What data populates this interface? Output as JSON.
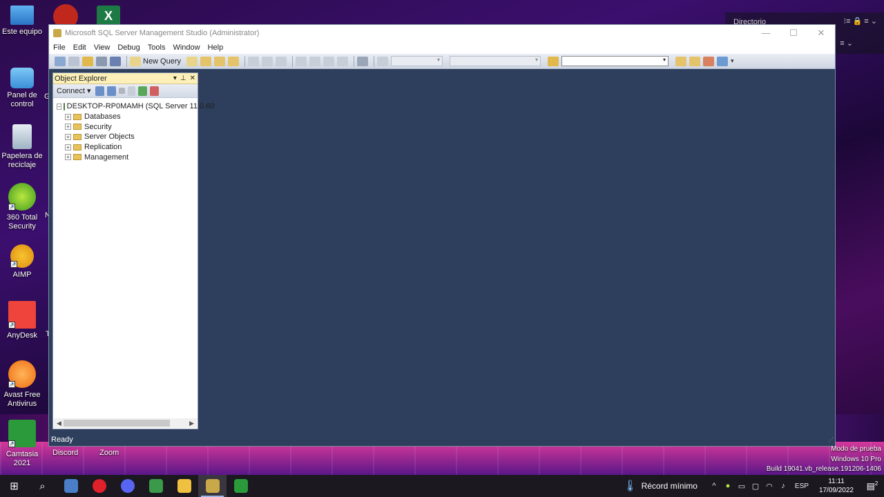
{
  "desktop": {
    "icons": [
      {
        "label": "Este equipo"
      },
      {
        "label": "Panel de control"
      },
      {
        "label": "Papelera de reciclaje"
      },
      {
        "label": "360 Total Security"
      },
      {
        "label": "AIMP"
      },
      {
        "label": "AnyDesk"
      },
      {
        "label": "Avast Free Antivirus"
      },
      {
        "label": "Camtasia 2021"
      }
    ],
    "bottom_labels": [
      "Discord",
      "Zoom"
    ],
    "partial_letters": [
      "G",
      "N",
      "T"
    ]
  },
  "bg_window": {
    "title": "Directorio"
  },
  "ssms": {
    "title": "Microsoft SQL Server Management Studio (Administrator)",
    "menu": [
      "File",
      "Edit",
      "View",
      "Debug",
      "Tools",
      "Window",
      "Help"
    ],
    "toolbar": {
      "new_query_label": "New Query"
    },
    "object_explorer": {
      "title": "Object Explorer",
      "connect_label": "Connect",
      "server": "DESKTOP-RP0MAMH (SQL Server 11.0.60",
      "nodes": [
        "Databases",
        "Security",
        "Server Objects",
        "Replication",
        "Management"
      ]
    },
    "status": "Ready"
  },
  "watermark": {
    "line1": "Modo de prueba",
    "line2": "Windows 10 Pro",
    "line3": "Build 19041.vb_release.191206-1406"
  },
  "taskbar": {
    "weather_text": "Récord mínimo",
    "language": "ESP",
    "time": "11:11",
    "date": "17/09/2022",
    "notification_count": "2"
  },
  "colors": {
    "workspace": "#2d3f5c",
    "oe_header": "#fcf0b8",
    "taskbar": "#1b1820"
  }
}
